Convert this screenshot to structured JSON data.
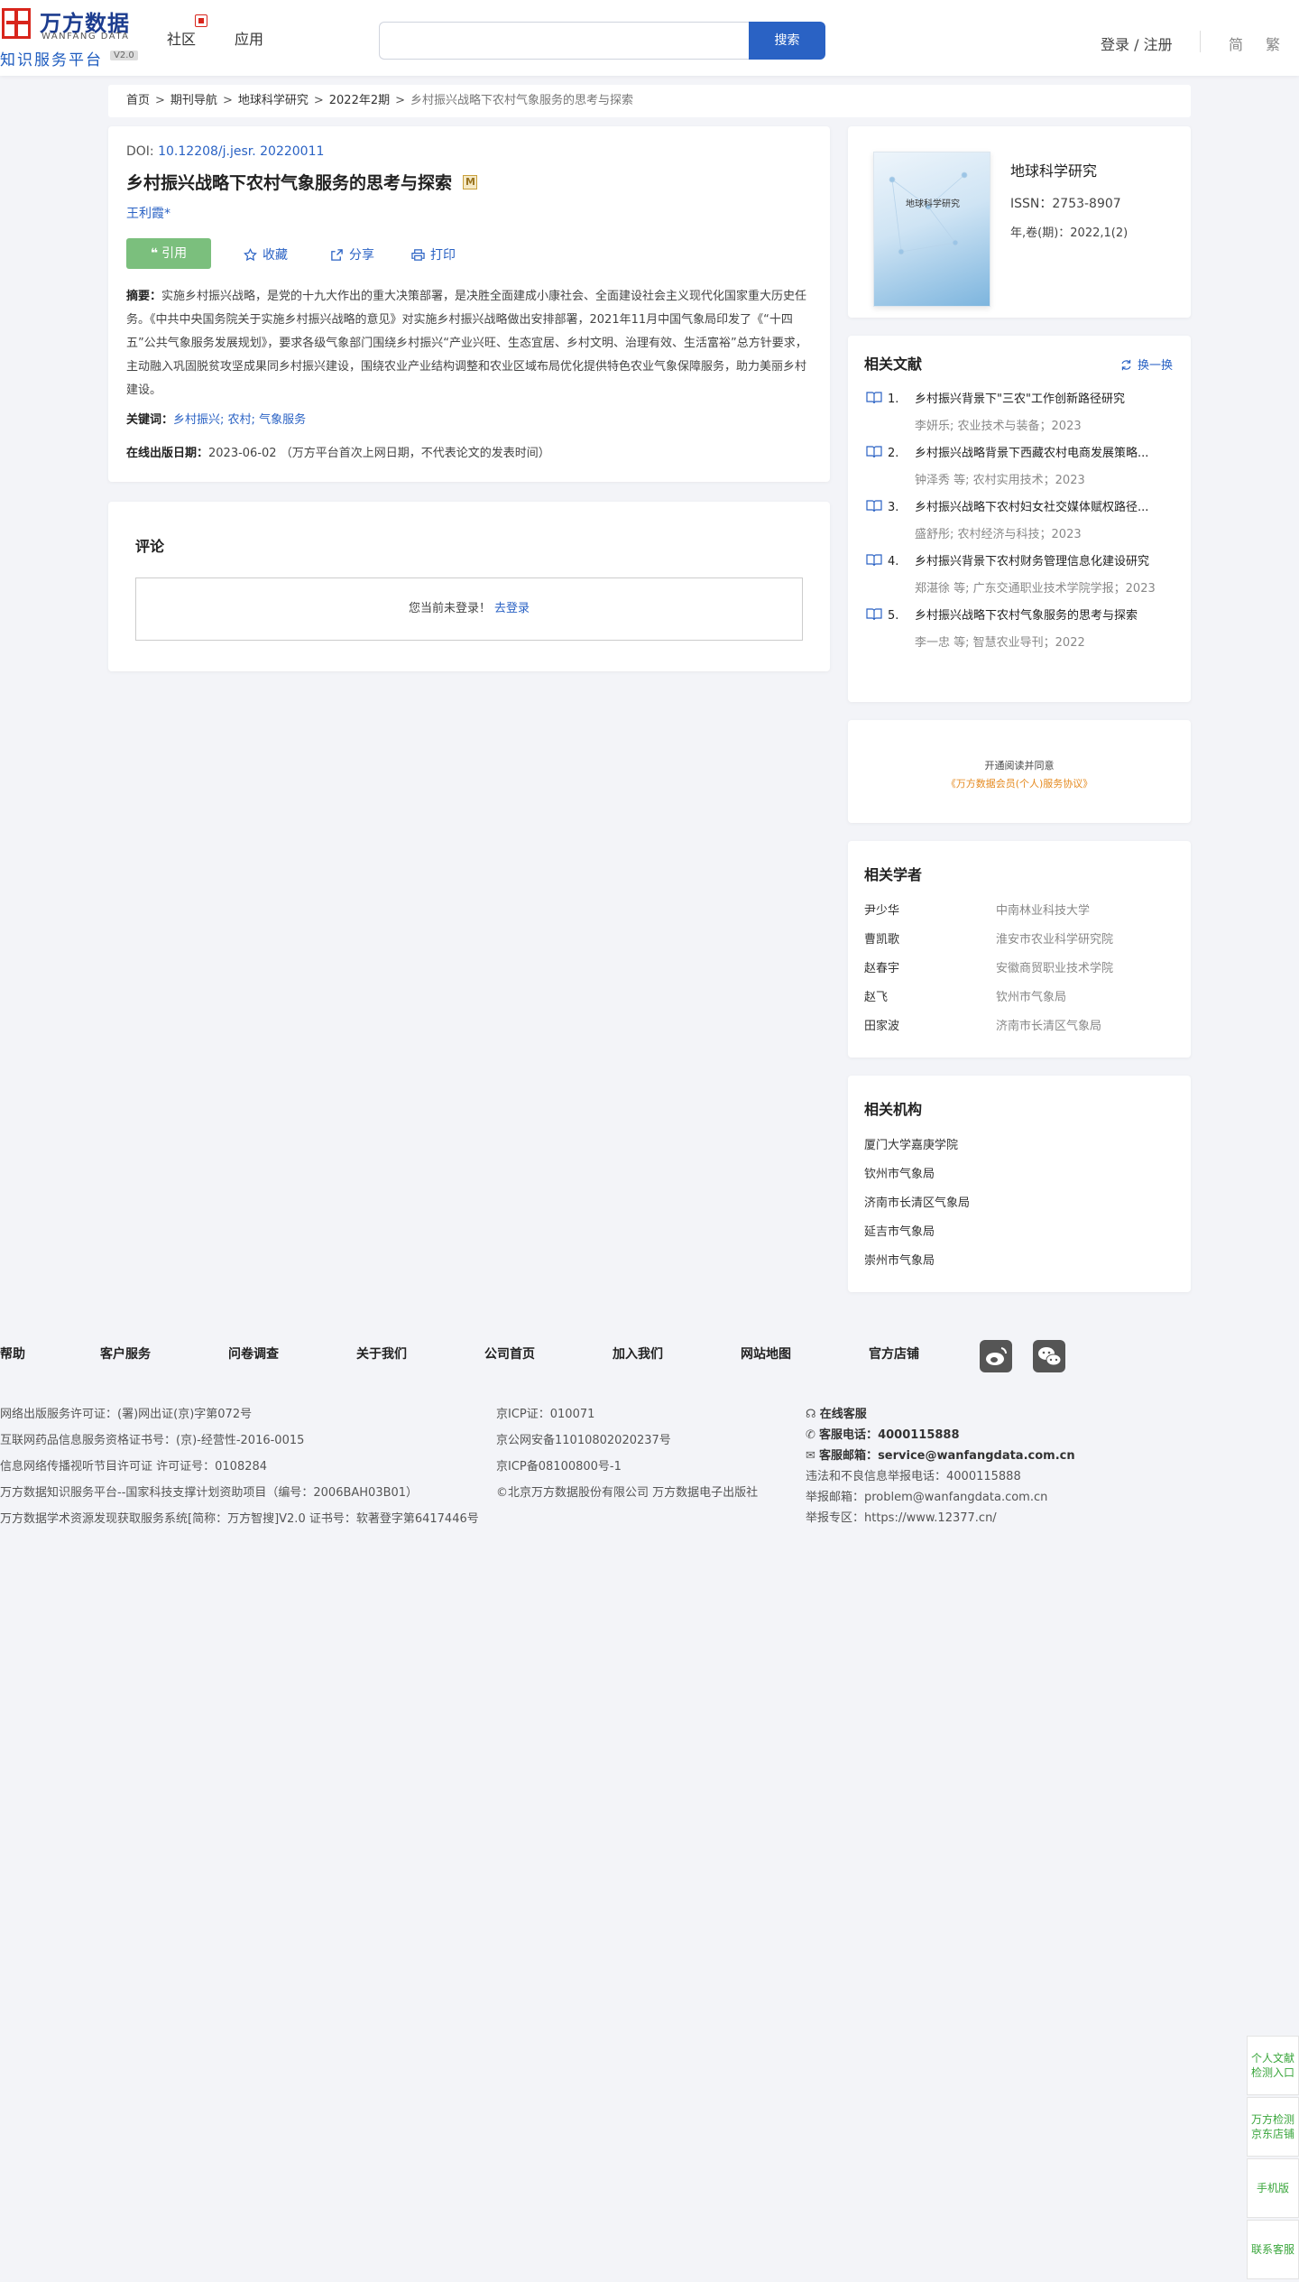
{
  "header": {
    "logo_cn": "万方数据",
    "logo_en": "WANFANG DATA",
    "logo_sub": "知识服务平台",
    "logo_ver": "V2.0",
    "nav": [
      "社区",
      "应用"
    ],
    "search_placeholder": "",
    "search_button": "搜索",
    "login": "登录 / 注册",
    "lang_simplified": "简",
    "lang_traditional": "繁"
  },
  "breadcrumb": {
    "items": [
      "首页",
      "期刊导航",
      "地球科学研究",
      "2022年2期"
    ],
    "current": "乡村振兴战略下农村气象服务的思考与探索",
    "sep": ">"
  },
  "article": {
    "doi_label": "DOI: ",
    "doi": "10.12208/j.jesr. 20220011",
    "title": "乡村振兴战略下农村气象服务的思考与探索",
    "badge": "M",
    "author": "王利霞*",
    "actions": {
      "cite": "引用",
      "collect": "收藏",
      "share": "分享",
      "print": "打印"
    },
    "abstract_label": "摘要：",
    "abstract": "实施乡村振兴战略，是党的十九大作出的重大决策部署，是决胜全面建成小康社会、全面建设社会主义现代化国家重大历史任务。《中共中央国务院关于实施乡村振兴战略的意见》对实施乡村振兴战略做出安排部署，2021年11月中国气象局印发了《“十四五”公共气象服务发展规划》，要求各级气象部门围绕乡村振兴“产业兴旺、生态宜居、乡村文明、治理有效、生活富裕”总方针要求，主动融入巩固脱贫攻坚成果同乡村振兴建设，围绕农业产业结构调整和农业区域布局优化提供特色农业气象保障服务，助力美丽乡村建设。",
    "keywords_label": "关键词：",
    "keywords": [
      "乡村振兴;",
      "农村;",
      "气象服务"
    ],
    "pubdate_label": "在线出版日期：",
    "pubdate": "2023-06-02 （万方平台首次上网日期，不代表论文的发表时间）"
  },
  "comment": {
    "title": "评论",
    "notice": "您当前未登录！",
    "login_link": "去登录"
  },
  "journal": {
    "cover_title": "地球科学研究",
    "name": "地球科学研究",
    "issn": "ISSN：2753-8907",
    "volume": "年,卷(期)：2022,1(2)"
  },
  "related": {
    "title": "相关文献",
    "refresh": "换一换",
    "items": [
      {
        "num": "1.",
        "title": "乡村振兴背景下\"三农\"工作创新路径研究",
        "author": "李妍乐;",
        "source": " 农业技术与装备；2023"
      },
      {
        "num": "2.",
        "title": "乡村振兴战略背景下西藏农村电商发展策略...",
        "author": "钟泽秀 等;",
        "source": " 农村实用技术；2023"
      },
      {
        "num": "3.",
        "title": "乡村振兴战略下农村妇女社交媒体赋权路径...",
        "author": "盛舒彤;",
        "source": " 农村经济与科技；2023"
      },
      {
        "num": "4.",
        "title": "乡村振兴背景下农村财务管理信息化建设研究",
        "author": "郑湛徐 等;",
        "source": " 广东交通职业技术学院学报；2023"
      },
      {
        "num": "5.",
        "title": "乡村振兴战略下农村气象服务的思考与探索",
        "author": "李一忠 等;",
        "source": " 智慧农业导刊；2022"
      }
    ]
  },
  "agreement": {
    "line1": "开通阅读并同意",
    "line2": "《万方数据会员(个人)服务协议》"
  },
  "scholars": {
    "title": "相关学者",
    "rows": [
      {
        "name": "尹少华",
        "org": "中南林业科技大学"
      },
      {
        "name": "曹凯歌",
        "org": "淮安市农业科学研究院"
      },
      {
        "name": "赵春宇",
        "org": "安徽商贸职业技术学院"
      },
      {
        "name": "赵飞",
        "org": "钦州市气象局"
      },
      {
        "name": "田家波",
        "org": "济南市长清区气象局"
      }
    ]
  },
  "institutions": {
    "title": "相关机构",
    "rows": [
      "厦门大学嘉庚学院",
      "钦州市气象局",
      "济南市长清区气象局",
      "延吉市气象局",
      "崇州市气象局"
    ]
  },
  "footer": {
    "nav": [
      "帮助",
      "客户服务",
      "问卷调查",
      "关于我们",
      "公司首页",
      "加入我们",
      "网站地图",
      "官方店铺"
    ],
    "col1": [
      "网络出版服务许可证：(署)网出证(京)字第072号",
      "互联网药品信息服务资格证书号：(京)-经营性-2016-0015",
      "信息网络传播视听节目许可证 许可证号：0108284",
      "万方数据知识服务平台--国家科技支撑计划资助项目（编号：2006BAH03B01）",
      "万方数据学术资源发现获取服务系统[简称：万方智搜]V2.0 证书号：软著登字第6417446号"
    ],
    "col2": [
      "京ICP证：010071",
      "京公网安备11010802020237号",
      "京ICP备08100800号-1",
      "©北京万方数据股份有限公司 万方数据电子出版社"
    ],
    "online_service": "在线客服",
    "phone_label": "客服电话：",
    "phone": "4000115888",
    "email_label": "客服邮箱：",
    "email": "service@wanfangdata.com.cn",
    "report_phone": "违法和不良信息举报电话：4000115888",
    "report_email": "举报邮箱：problem@wanfangdata.com.cn",
    "report_site": "举报专区：https://www.12377.cn/"
  },
  "float_bar": [
    "个人文献检测入口",
    "万方检测京东店铺",
    "手机版",
    "联系客服"
  ],
  "colors": {
    "brand_blue": "#2a62c4",
    "cite_green": "#7bbf7d",
    "logo_red": "#d8251c",
    "float_green": "#3aa63c"
  }
}
